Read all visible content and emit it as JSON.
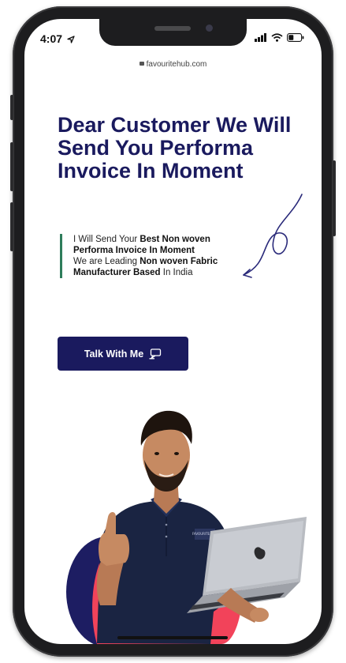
{
  "status_bar": {
    "time": "4:07"
  },
  "browser": {
    "url": "favouritehub.com"
  },
  "hero": {
    "headline": "Dear Customer We Will Send You Performa Invoice In Moment",
    "desc_line1_regular": "I Will Send Your ",
    "desc_line1_bold": "Best Non woven Performa Invoice In Moment",
    "desc_line2_regular": "We are Leading ",
    "desc_line2_bold": "Non woven Fabric Manufacturer Based",
    "desc_line2_tail": " In India",
    "cta_label": "Talk With Me",
    "shirt_logo": "FAVOURITE HUB"
  },
  "colors": {
    "brand_navy": "#1a1a5e",
    "accent_green": "#2e7d5b",
    "accent_red": "#f2435a"
  },
  "icons": {
    "cta": "chat-icon",
    "doodle": "curly-arrow-icon",
    "status": [
      "location-arrow-icon",
      "signal-icon",
      "wifi-icon",
      "battery-icon"
    ]
  }
}
